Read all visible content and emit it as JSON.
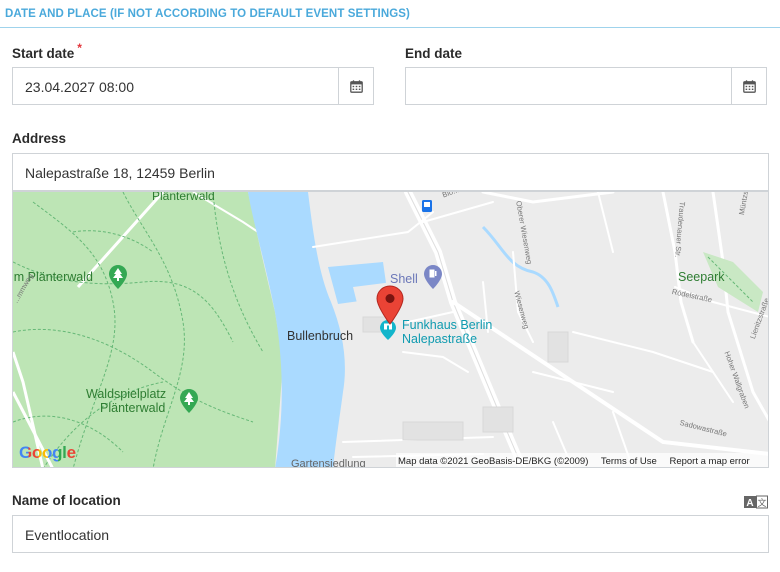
{
  "section": {
    "title": "DATE AND PLACE (IF NOT ACCORDING TO DEFAULT EVENT SETTINGS)"
  },
  "start": {
    "label": "Start date",
    "required_mark": "*",
    "value": "23.04.2027 08:00"
  },
  "end": {
    "label": "End date",
    "value": ""
  },
  "address": {
    "label": "Address",
    "value": "Nalepastraße 18, 12459 Berlin"
  },
  "map": {
    "places": {
      "planterwald_top": "Plänterwald",
      "im_planterwald": "im Plänterwald",
      "waldspielplatz_1": "Waldspielplatz",
      "waldspielplatz_2": "Plänterwald",
      "bullenbruch": "Bullenbruch",
      "shell": "Shell",
      "funkhaus_1": "Funkhaus Berlin",
      "funkhaus_2": "Nalepastraße",
      "seepark": "Seepark",
      "gartensiedlung": "Gartensiedlung"
    },
    "streets": {
      "wiesenweg": "Wiesenweg",
      "oberer_wiesenweg": "Oberer Wiesenweg",
      "traudenauer": "Traudenauer Str.",
      "rodelstrasse": "Rödelstraße",
      "lienitzstrasse": "Lienitzstraße",
      "hoher_wallgraben": "Hoher Wallgraben",
      "sadowastrasse": "Sadowastraße",
      "muntzstrasse": "Müntzs...",
      "blo": "Blo...",
      "ritterweg": "...mmweg"
    },
    "logo": "Google",
    "footer": {
      "data": "Map data ©2021 GeoBasis-DE/BKG (©2009)",
      "terms": "Terms of Use",
      "report": "Report a map error"
    },
    "colors": {
      "water": "#aadaff",
      "park": "#bde5b5",
      "road": "#ffffff",
      "pin": "#ea4335",
      "poi": "#12b5cb"
    }
  },
  "location": {
    "label": "Name of location",
    "value": "Eventlocation"
  }
}
